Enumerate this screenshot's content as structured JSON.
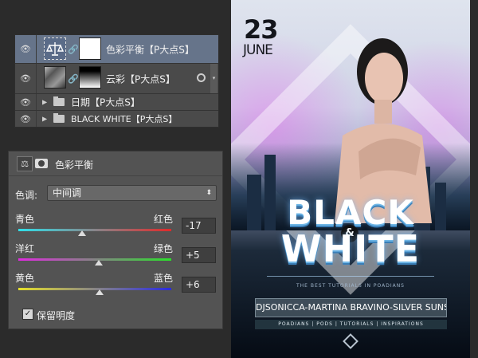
{
  "layers": [
    {
      "name": "色彩平衡【P大点S】",
      "selected": true,
      "kind": "adjustment"
    },
    {
      "name": "云彩【P大点S】",
      "selected": false,
      "kind": "pixel"
    },
    {
      "name": "日期【P大点S】",
      "selected": false,
      "kind": "group"
    },
    {
      "name": "BLACK WHITE【P大点S】",
      "selected": false,
      "kind": "group"
    }
  ],
  "properties": {
    "title": "色彩平衡",
    "tone_label": "色调:",
    "tone_value": "中间调",
    "sliders": [
      {
        "left": "青色",
        "right": "红色",
        "value": "-17",
        "level": -17
      },
      {
        "left": "洋红",
        "right": "绿色",
        "value": "+5",
        "level": 5
      },
      {
        "left": "黄色",
        "right": "蓝色",
        "value": "+6",
        "level": 6
      }
    ],
    "preserve_label": "保留明度",
    "preserve_checked": true
  },
  "poster": {
    "day": "23",
    "month": "JUNE",
    "title_top": "BLACK",
    "amp": "&",
    "title_bottom": "WHITE",
    "tagline": "THE BEST TUTORIALS IN POADIANS",
    "banner": "DJSONICCA-MARTINA BRAVINO-SILVER SUNSET",
    "subline": "POADIANS | PODS | TUTORIALS | INSPIRATIONS"
  }
}
